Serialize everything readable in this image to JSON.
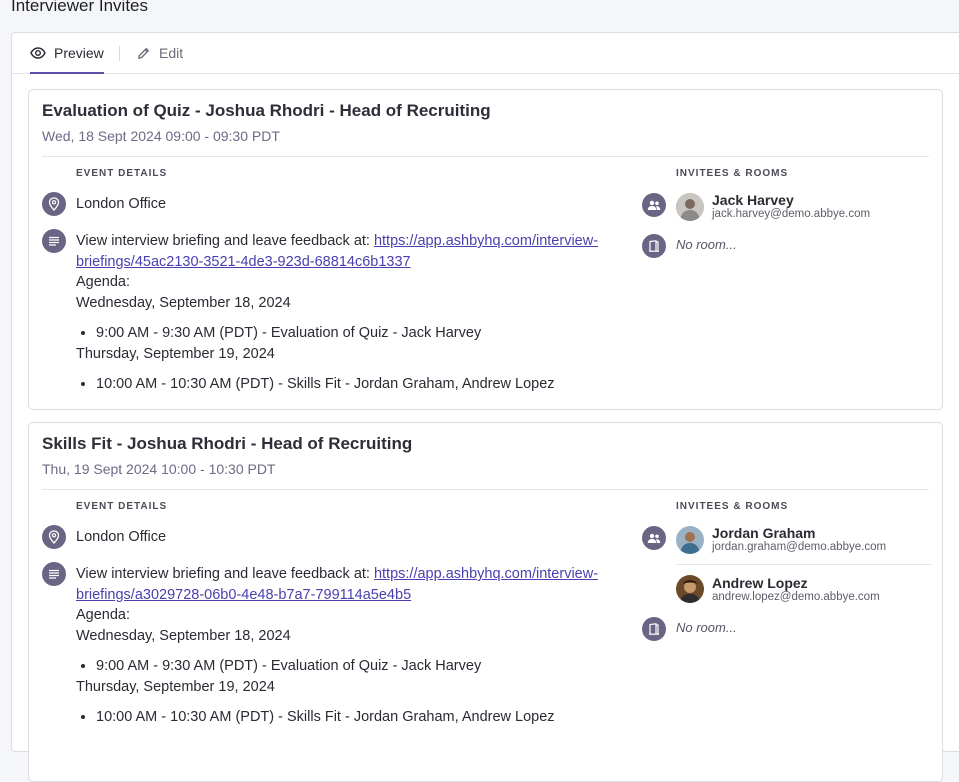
{
  "page": {
    "title": "Interviewer Invites"
  },
  "tabs": [
    {
      "label": "Preview",
      "icon": "eye-icon",
      "active": true
    },
    {
      "label": "Edit",
      "icon": "pencil-icon",
      "active": false
    }
  ],
  "labels": {
    "event_details": "EVENT DETAILS",
    "invitees_rooms": "INVITEES & ROOMS"
  },
  "colors": {
    "accent": "#5b4fa8",
    "link": "#4a3fae",
    "icon_bg": "#6a6584"
  },
  "events": [
    {
      "title": "Evaluation of Quiz - Joshua Rhodri - Head of Recruiting",
      "datetime": "Wed, 18 Sept 2024 09:00 - 09:30 PDT",
      "location": "London Office",
      "description_prefix": "View interview briefing and leave feedback at: ",
      "link": "https://app.ashbyhq.com/interview-briefings/45ac2130-3521-4de3-923d-68814c6b1337",
      "agenda_label": "Agenda:",
      "day1": "Wednesday, September 18, 2024",
      "day1_item": "9:00 AM - 9:30 AM (PDT) - Evaluation of Quiz - Jack Harvey",
      "day2": "Thursday, September 19, 2024",
      "day2_item": "10:00 AM - 10:30 AM (PDT) - Skills Fit - Jordan Graham, Andrew Lopez",
      "invitees": [
        {
          "name": "Jack Harvey",
          "email": "jack.harvey@demo.abbye.com"
        }
      ],
      "room": "No room..."
    },
    {
      "title": "Skills Fit - Joshua Rhodri - Head of Recruiting",
      "datetime": "Thu, 19 Sept 2024 10:00 - 10:30 PDT",
      "location": "London Office",
      "description_prefix": "View interview briefing and leave feedback at: ",
      "link": "https://app.ashbyhq.com/interview-briefings/a3029728-06b0-4e48-b7a7-799114a5e4b5",
      "agenda_label": "Agenda:",
      "day1": "Wednesday, September 18, 2024",
      "day1_item": "9:00 AM - 9:30 AM (PDT) - Evaluation of Quiz - Jack Harvey",
      "day2": "Thursday, September 19, 2024",
      "day2_item": "10:00 AM - 10:30 AM (PDT) - Skills Fit - Jordan Graham, Andrew Lopez",
      "invitees": [
        {
          "name": "Jordan Graham",
          "email": "jordan.graham@demo.abbye.com"
        },
        {
          "name": "Andrew Lopez",
          "email": "andrew.lopez@demo.abbye.com"
        }
      ],
      "room": "No room..."
    }
  ]
}
